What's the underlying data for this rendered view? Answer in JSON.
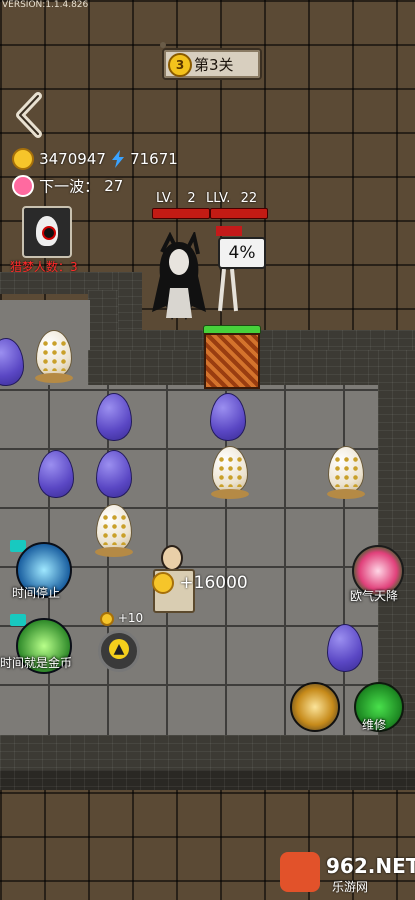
{
  "version": "VERSION:1.1.4.826",
  "level": {
    "badge": "3",
    "title": "第3关"
  },
  "hud": {
    "gold": "3470947",
    "energy": "71671",
    "next_wave_label": "下一波：",
    "next_wave_value": "27"
  },
  "hunters": {
    "label": "猎梦人数：",
    "count": "3"
  },
  "enemies": [
    {
      "name": "ghost",
      "level_label": "LV.",
      "level": "2"
    },
    {
      "name": "skeleton",
      "level_label": "LLV.",
      "level": "22"
    }
  ],
  "door": {
    "hp_percent": "4%",
    "health": 1.0
  },
  "gold_gain": "+16000",
  "upgrade": {
    "bonus": "+10"
  },
  "buttons": {
    "time_stop": "时间停止",
    "time_is_money": "时间就是金币",
    "luck": "欧气天降",
    "repair": "维修"
  },
  "watermark": {
    "brand": "962.NET",
    "sub": "乐游网"
  },
  "eggs": [
    {
      "type": "purple"
    },
    {
      "type": "gold"
    },
    {
      "type": "purple"
    },
    {
      "type": "purple"
    },
    {
      "type": "purple"
    },
    {
      "type": "purple"
    },
    {
      "type": "gold"
    },
    {
      "type": "gold"
    },
    {
      "type": "gold"
    },
    {
      "type": "purple"
    }
  ],
  "colors": {
    "enemy_hp": "#c31b14",
    "door_hp": "#47d13b",
    "hunter_text": "#ff2a2a"
  }
}
